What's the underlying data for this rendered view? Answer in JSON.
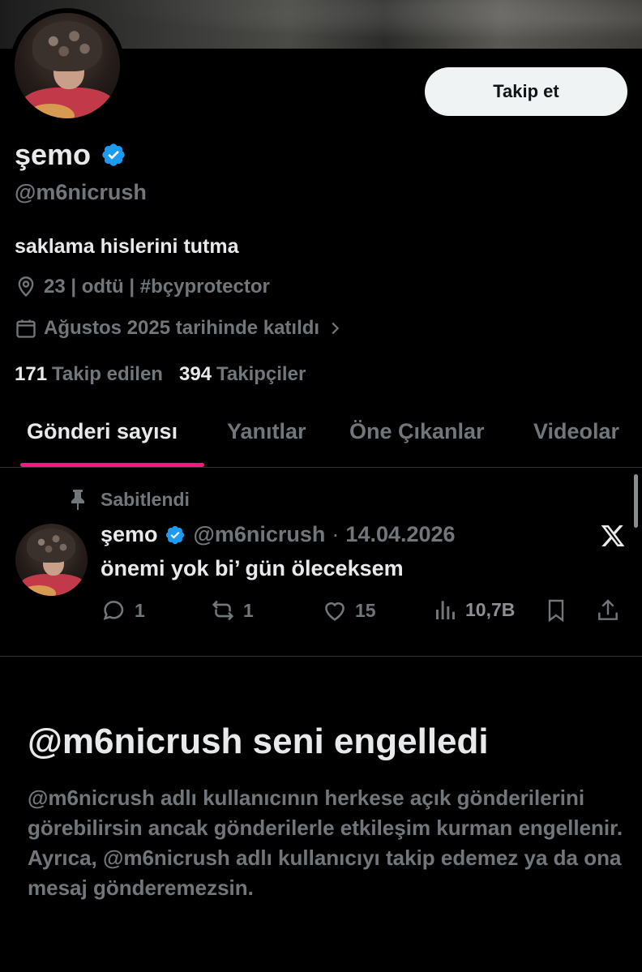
{
  "profile": {
    "follow_label": "Takip et",
    "display_name": "şemo",
    "handle": "@m6nicrush",
    "bio": "saklama hislerini tutma",
    "location": "23 | odtü | #bçyprotector",
    "joined": "Ağustos 2025 tarihinde katıldı",
    "following_count": "171",
    "following_label": "Takip edilen",
    "followers_count": "394",
    "followers_label": "Takipçiler"
  },
  "tabs": [
    {
      "label": "Gönderi sayısı",
      "active": true
    },
    {
      "label": "Yanıtlar",
      "active": false
    },
    {
      "label": "Öne Çıkanlar",
      "active": false
    },
    {
      "label": "Videolar",
      "active": false
    }
  ],
  "post": {
    "pinned_label": "Sabitlendi",
    "name": "şemo",
    "handle": "@m6nicrush",
    "dot": "·",
    "date": "14.04.2026",
    "text": "önemi yok bi’ gün öleceksem",
    "replies": "1",
    "reposts": "1",
    "likes": "15",
    "views": "10,7B"
  },
  "blocked": {
    "title": "@m6nicrush seni engelledi",
    "description": "@m6nicrush adlı kullanıcının herkese açık gönderilerini görebilirsin ancak gönderilerle etkileşim kurman engellenir. Ayrıca, @m6nicrush adlı kullanıcıyı takip edemez ya da ona mesaj gönderemezsin."
  },
  "colors": {
    "accent_pink": "#f91880",
    "verified_blue": "#1d9bf0",
    "muted": "#71767b",
    "text": "#e7e9ea"
  },
  "icons": [
    "location-pin-icon",
    "calendar-icon",
    "chevron-right-icon",
    "verified-badge-icon",
    "pin-icon",
    "x-logo-icon",
    "reply-icon",
    "repost-icon",
    "like-icon",
    "views-icon",
    "bookmark-icon",
    "share-icon"
  ]
}
